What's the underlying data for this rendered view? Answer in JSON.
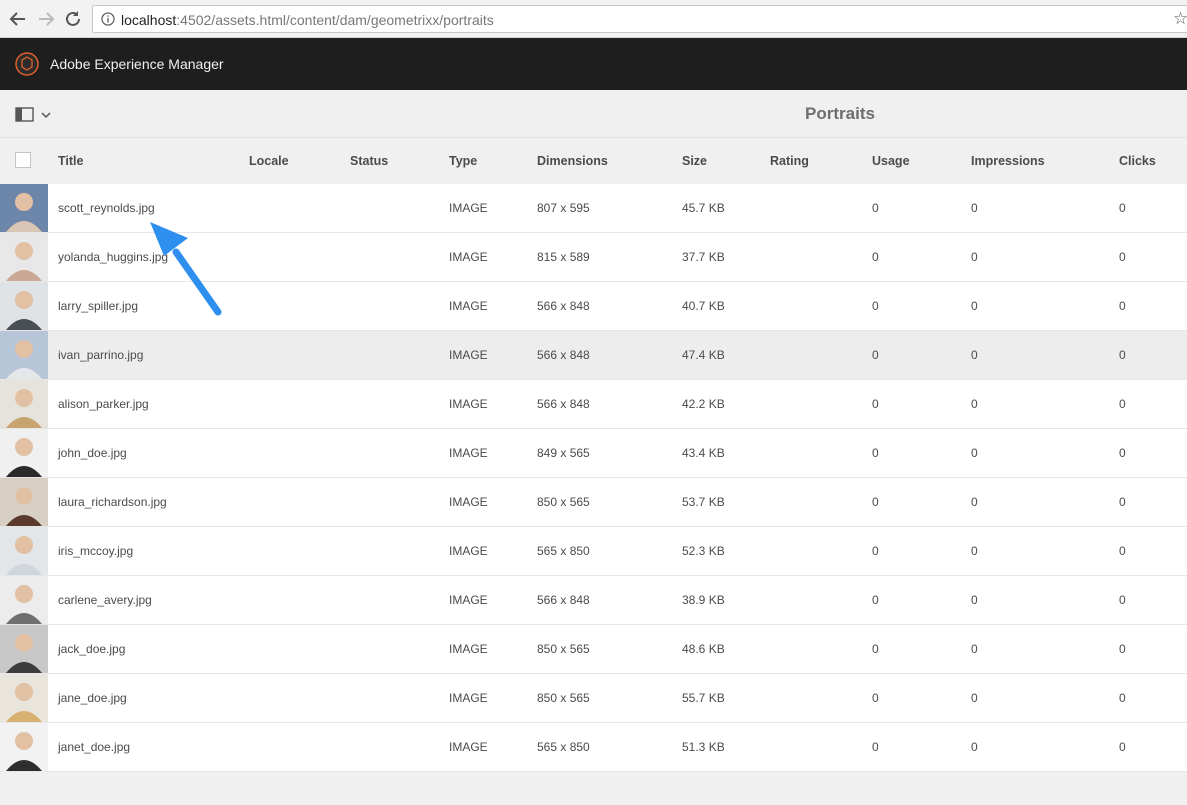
{
  "browser": {
    "url_host": "localhost",
    "url_path": ":4502/assets.html/content/dam/geometrixx/portraits"
  },
  "app": {
    "title": "Adobe Experience Manager"
  },
  "toolbar": {
    "page_title": "Portraits"
  },
  "table": {
    "columns": [
      "Title",
      "Locale",
      "Status",
      "Type",
      "Dimensions",
      "Size",
      "Rating",
      "Usage",
      "Impressions",
      "Clicks"
    ],
    "rows": [
      {
        "title": "scott_reynolds.jpg",
        "type": "IMAGE",
        "dimensions": "807 x 595",
        "size": "45.7 KB",
        "usage": "0",
        "impressions": "0",
        "clicks": "0"
      },
      {
        "title": "yolanda_huggins.jpg",
        "type": "IMAGE",
        "dimensions": "815 x 589",
        "size": "37.7 KB",
        "usage": "0",
        "impressions": "0",
        "clicks": "0"
      },
      {
        "title": "larry_spiller.jpg",
        "type": "IMAGE",
        "dimensions": "566 x 848",
        "size": "40.7 KB",
        "usage": "0",
        "impressions": "0",
        "clicks": "0"
      },
      {
        "title": "ivan_parrino.jpg",
        "type": "IMAGE",
        "dimensions": "566 x 848",
        "size": "47.4 KB",
        "usage": "0",
        "impressions": "0",
        "clicks": "0"
      },
      {
        "title": "alison_parker.jpg",
        "type": "IMAGE",
        "dimensions": "566 x 848",
        "size": "42.2 KB",
        "usage": "0",
        "impressions": "0",
        "clicks": "0"
      },
      {
        "title": "john_doe.jpg",
        "type": "IMAGE",
        "dimensions": "849 x 565",
        "size": "43.4 KB",
        "usage": "0",
        "impressions": "0",
        "clicks": "0"
      },
      {
        "title": "laura_richardson.jpg",
        "type": "IMAGE",
        "dimensions": "850 x 565",
        "size": "53.7 KB",
        "usage": "0",
        "impressions": "0",
        "clicks": "0"
      },
      {
        "title": "iris_mccoy.jpg",
        "type": "IMAGE",
        "dimensions": "565 x 850",
        "size": "52.3 KB",
        "usage": "0",
        "impressions": "0",
        "clicks": "0"
      },
      {
        "title": "carlene_avery.jpg",
        "type": "IMAGE",
        "dimensions": "566 x 848",
        "size": "38.9 KB",
        "usage": "0",
        "impressions": "0",
        "clicks": "0"
      },
      {
        "title": "jack_doe.jpg",
        "type": "IMAGE",
        "dimensions": "850 x 565",
        "size": "48.6 KB",
        "usage": "0",
        "impressions": "0",
        "clicks": "0"
      },
      {
        "title": "jane_doe.jpg",
        "type": "IMAGE",
        "dimensions": "850 x 565",
        "size": "55.7 KB",
        "usage": "0",
        "impressions": "0",
        "clicks": "0"
      },
      {
        "title": "janet_doe.jpg",
        "type": "IMAGE",
        "dimensions": "565 x 850",
        "size": "51.3 KB",
        "usage": "0",
        "impressions": "0",
        "clicks": "0"
      }
    ]
  },
  "icons": {
    "back": "back-arrow-icon",
    "forward": "forward-arrow-icon",
    "reload": "reload-icon",
    "info": "info-icon",
    "star": "bookmark-star-icon",
    "logo": "aem-logo-icon",
    "rail": "rail-toggle-icon",
    "annotation": "annotation-arrow-icon"
  },
  "colors": {
    "header_bg": "#1e1e1e",
    "logo_accent": "#e0612b",
    "arrow": "#2f8fef",
    "hover_row": "#ededed"
  }
}
